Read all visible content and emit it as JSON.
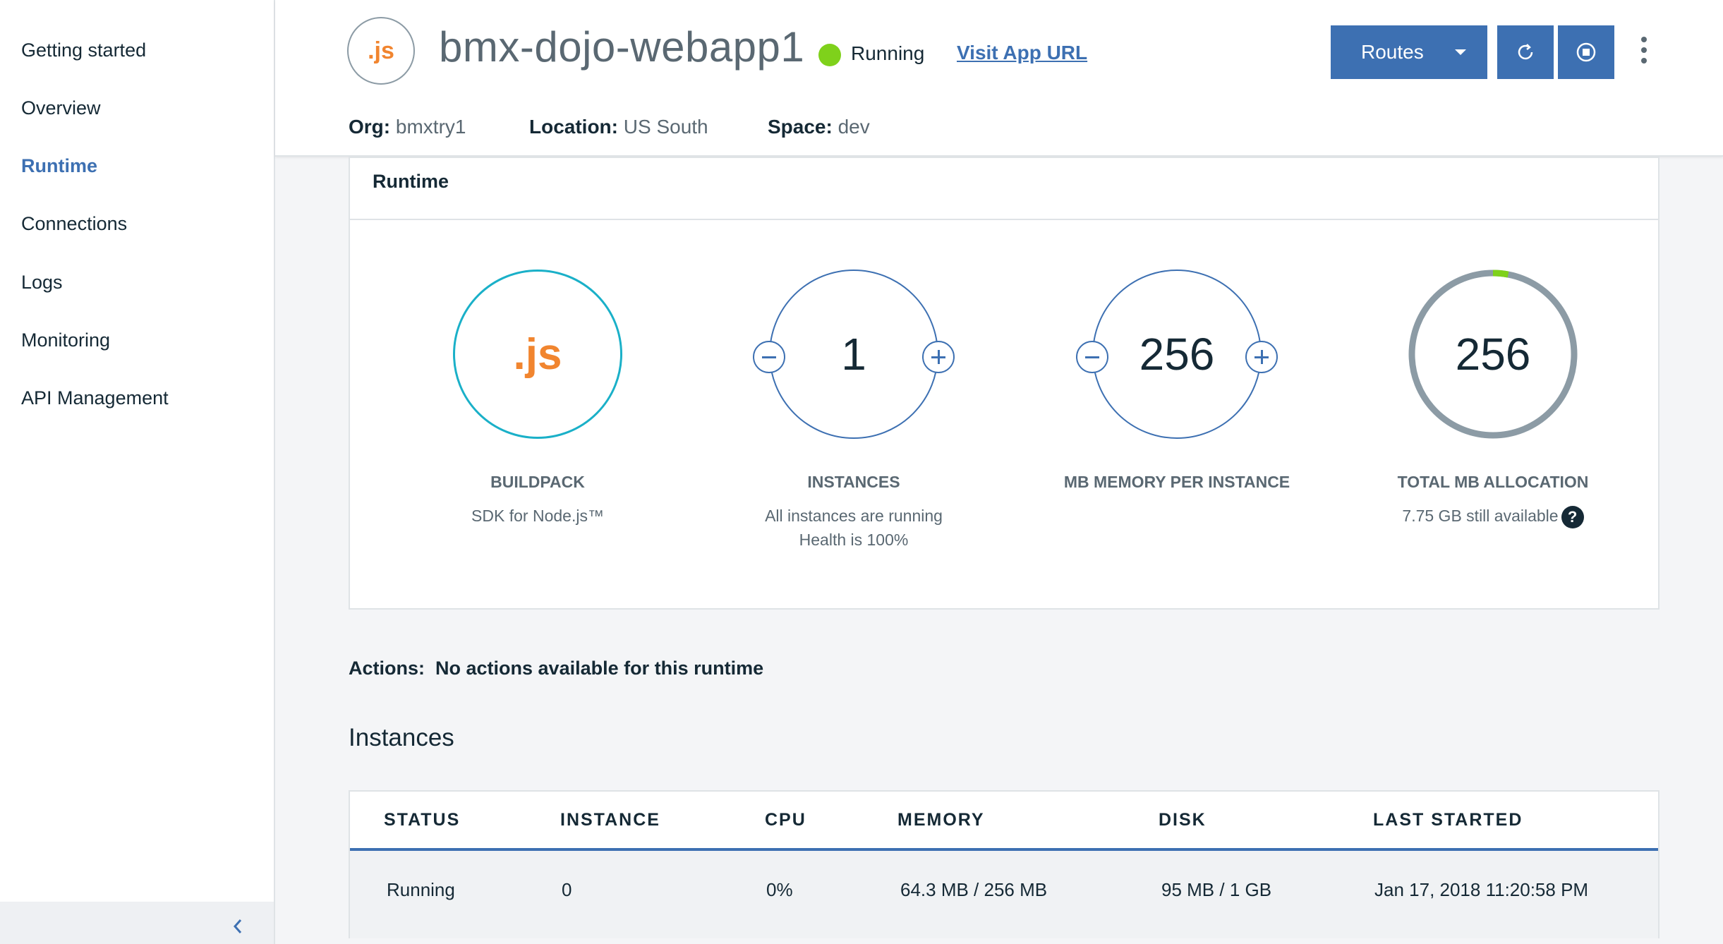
{
  "sidebar": {
    "items": [
      {
        "label": "Getting started"
      },
      {
        "label": "Overview"
      },
      {
        "label": "Runtime"
      },
      {
        "label": "Connections"
      },
      {
        "label": "Logs"
      },
      {
        "label": "Monitoring"
      },
      {
        "label": "API Management"
      }
    ],
    "active": "Runtime"
  },
  "header": {
    "app_icon_text": ".js",
    "app_name": "bmx-dojo-webapp1",
    "status": "Running",
    "status_color": "#7fd11b",
    "visit_link": "Visit App URL",
    "routes_label": "Routes",
    "restart_icon": "restart-icon",
    "stop_icon": "stop-icon",
    "more_icon": "overflow-menu-icon",
    "org_label": "Org:",
    "org_value": "bmxtry1",
    "location_label": "Location:",
    "location_value": "US South",
    "space_label": "Space:",
    "space_value": "dev"
  },
  "runtime": {
    "title": "Runtime",
    "buildpack": {
      "icon_text": ".js",
      "label": "BUILDPACK",
      "sub": "SDK for Node.js™"
    },
    "instances": {
      "value": "1",
      "label": "INSTANCES",
      "sub1": "All instances are running",
      "sub2": "Health is 100%"
    },
    "memory": {
      "value": "256",
      "label": "MB MEMORY PER INSTANCE"
    },
    "total": {
      "value": "256",
      "label": "TOTAL MB ALLOCATION",
      "sub": "7.75 GB still available",
      "help": "?",
      "used_fraction": 0.03
    }
  },
  "actions": {
    "label": "Actions:",
    "text": "No actions available for this runtime"
  },
  "instances_table": {
    "title": "Instances",
    "columns": [
      "STATUS",
      "INSTANCE",
      "CPU",
      "MEMORY",
      "DISK",
      "LAST STARTED"
    ],
    "rows": [
      [
        "Running",
        "0",
        "0%",
        "64.3 MB / 256 MB",
        "95 MB / 1 GB",
        "Jan 17, 2018 11:20:58 PM"
      ]
    ]
  },
  "colors": {
    "accent": "#3d70b2",
    "buildpack_ring": "#1ab0c8",
    "js_orange": "#f1852f"
  }
}
